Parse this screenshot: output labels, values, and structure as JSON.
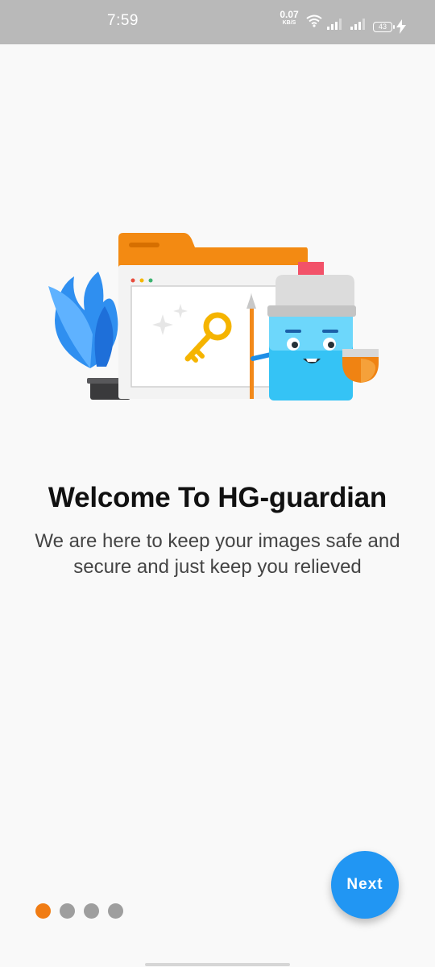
{
  "status_bar": {
    "time": "7:59",
    "net_speed_value": "0.07",
    "net_speed_unit": "KB/S",
    "battery_level": "43",
    "icons": [
      "wifi-icon",
      "signal-icon",
      "signal-icon",
      "battery-icon",
      "charging-icon"
    ]
  },
  "onboarding": {
    "title": "Welcome To HG-guardian",
    "subtitle_line1": "We are here to keep your images safe and",
    "subtitle_line2": "secure and just keep you relieved",
    "page_count": 4,
    "current_page": 1,
    "next_label": "Next"
  },
  "colors": {
    "accent": "#2196f3",
    "active_dot": "#f07c14",
    "inactive_dot": "#9e9e9e",
    "background": "#f9f9f9",
    "status_bar": "#b9b9b9"
  }
}
